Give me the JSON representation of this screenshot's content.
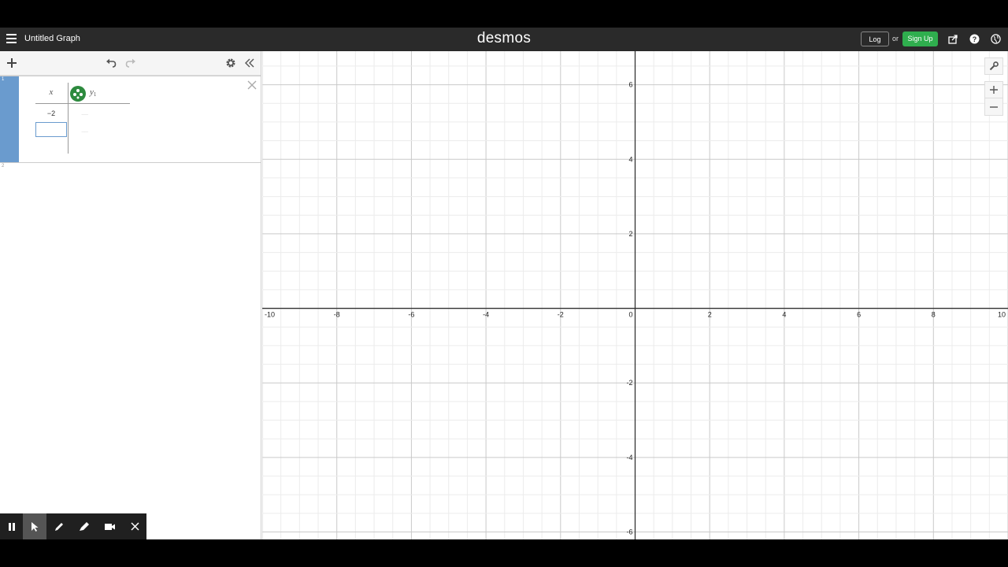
{
  "header": {
    "graph_title": "Untitled Graph",
    "brand": "desmos",
    "login_label": "Log In",
    "or_label": "or",
    "signup_label": "Sign Up"
  },
  "expression_list": {
    "row1_index": "1",
    "row2_index": "2",
    "table": {
      "x_header": "x",
      "y_header": "y",
      "y_subscript": "1",
      "cells": [
        "−2"
      ],
      "color": "#2d8a3e"
    }
  },
  "graph": {
    "x_ticks": [
      "-10",
      "-8",
      "-6",
      "-4",
      "-2",
      "0",
      "2",
      "4",
      "6",
      "8",
      "10"
    ],
    "y_ticks": [
      "6",
      "4",
      "2",
      "-2",
      "-4",
      "-6"
    ],
    "x_range": [
      -10,
      10
    ],
    "y_range": [
      -6.2,
      6.9
    ],
    "grid": true
  },
  "icons": {
    "menu": "hamburger-icon",
    "share": "share-icon",
    "help": "help-icon",
    "language": "globe-icon",
    "add": "plus-icon",
    "undo": "undo-icon",
    "redo": "redo-icon",
    "settings": "gear-icon",
    "collapse": "double-chevron-left-icon",
    "wrench": "wrench-icon",
    "zoom_in": "plus-icon",
    "zoom_out": "minus-icon"
  }
}
